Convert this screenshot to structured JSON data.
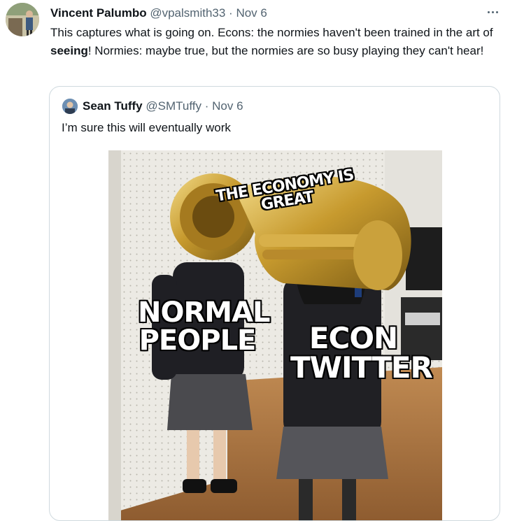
{
  "tweet": {
    "author_name": "Vincent Palumbo",
    "author_handle": "@vpalsmith33",
    "separator": "·",
    "date": "Nov 6",
    "text_before": "This captures what is going on. Econs: the normies haven't been trained in the art of ",
    "text_bold": "seeing",
    "text_after": "! Normies: maybe true, but the normies are so busy playing they can't hear!",
    "more_icon": "more-dots-icon"
  },
  "quoted_tweet": {
    "author_name": "Sean Tuffy",
    "author_handle": "@SMTuffy",
    "separator": "·",
    "date": "Nov 6",
    "text": "I’m sure this will eventually work",
    "meme": {
      "caption_top": "THE ECONOMY IS GREAT",
      "caption_left_1": "NORMAL",
      "caption_left_2": "PEOPLE",
      "caption_right_1": "ECON",
      "caption_right_2": "TWITTER"
    }
  },
  "colors": {
    "text_primary": "#0f1419",
    "text_secondary": "#536471",
    "border": "#cfd9de"
  }
}
